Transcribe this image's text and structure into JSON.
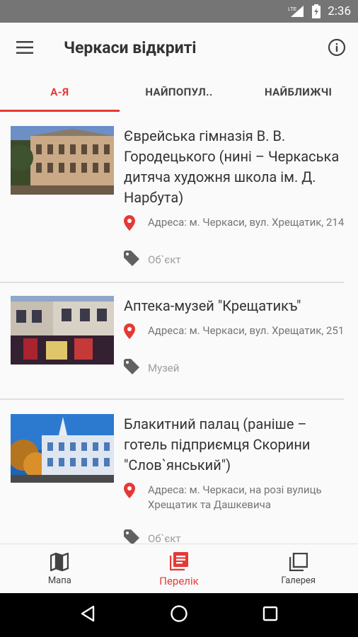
{
  "status_bar": {
    "time": "2:36",
    "network": "LTE"
  },
  "app_bar": {
    "title": "Черкаси відкриті"
  },
  "tabs": [
    {
      "label": "А-Я"
    },
    {
      "label": "НАЙПОПУЛ.."
    },
    {
      "label": "НАЙБЛИЖЧІ"
    }
  ],
  "list": {
    "items": [
      {
        "title": "Єврейська гімназія В. В. Городецького (нині – Черкаська дитяча художня школа ім. Д. Нарбута)",
        "address": "Адреса: м. Черкаси, вул. Хрещатик, 214",
        "category": "Об`єкт"
      },
      {
        "title": "Аптека-музей \"Крещатикъ\"",
        "address": "Адреса: м. Черкаси, вул. Хрещатик, 251",
        "category": "Музей"
      },
      {
        "title": "Блакитний палац (раніше – готель підприємця Скорини \"Слов`янський\")",
        "address": "Адреса: м. Черкаси, на розі вулиць Хрещатик та Дашкевича",
        "category": "Об`єкт"
      }
    ]
  },
  "bottom_nav": [
    {
      "label": "Мапа",
      "icon": "map-icon"
    },
    {
      "label": "Перелік",
      "icon": "list-icon"
    },
    {
      "label": "Галерея",
      "icon": "gallery-icon"
    }
  ],
  "colors": {
    "accent": "#e53935",
    "status_bar": "#757575"
  }
}
